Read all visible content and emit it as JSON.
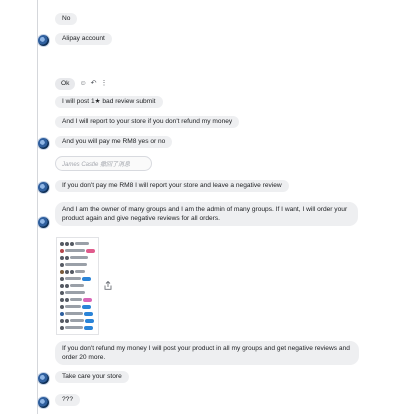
{
  "messages": [
    {
      "text": "No"
    },
    {
      "text": "Alipay account"
    },
    {
      "text": "I will post 1★ bad review submit"
    },
    {
      "text": "And I will report to your store if you don't refund my money"
    },
    {
      "text": "And you will pay me RM8 yes or no"
    },
    {
      "text": "If you don't pay me RM8 I will report your store and leave a negative review"
    },
    {
      "text": "And I am the owner of many groups and I am the admin of many groups. If I want, I will order your product again and give negative reviews for all orders."
    },
    {
      "text": "If you don't refund my money I will post your product in all my groups and get negative reviews and order 20 more."
    },
    {
      "text": "Take care your store"
    },
    {
      "text": "???"
    }
  ],
  "reaction_row": {
    "ok_label": "Ok",
    "emoji_icon": "smiley-icon",
    "reply_icon": "reply-icon",
    "more_icon": "more-icon"
  },
  "quoted": {
    "text": "James Castle 撤回了消息"
  },
  "image_attachment": {
    "icon": "screenshot-thumbnail",
    "share_icon": "share-icon"
  },
  "colors": {
    "bubble": "#eeeff1",
    "rail": "#d5d7db",
    "avatar": "#2f5f9e"
  }
}
